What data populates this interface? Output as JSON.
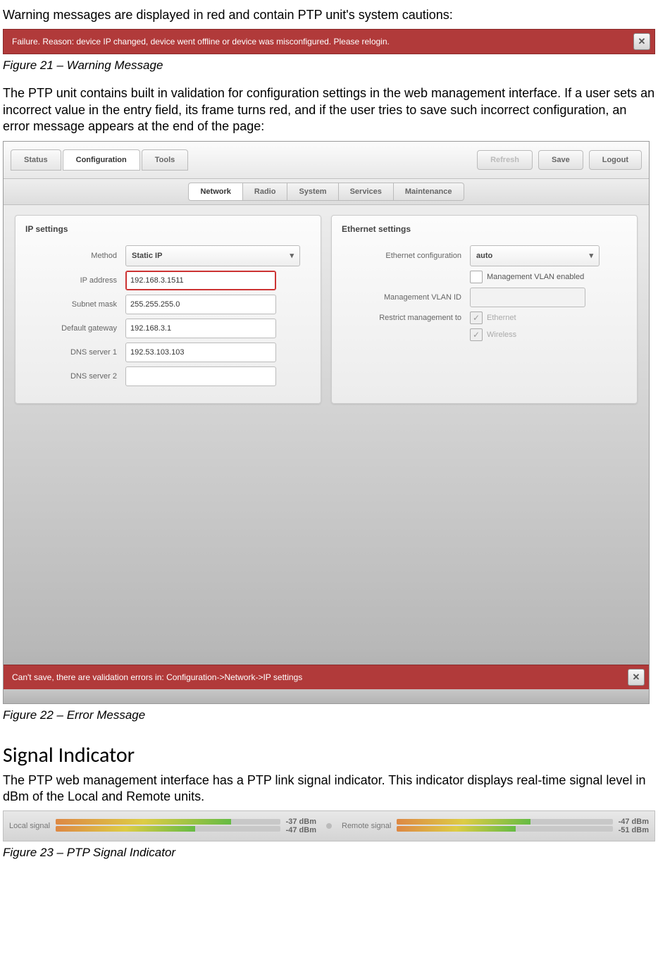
{
  "intro_para": "Warning messages are displayed in red and contain PTP unit's system cautions:",
  "fig21": {
    "text": "Failure. Reason: device IP changed, device went offline or device was misconfigured. Please relogin.",
    "caption": "Figure 21 – Warning Message"
  },
  "validation_para": "The PTP unit contains built in validation for configuration settings in the web management interface. If a user sets an incorrect value in the entry field, its frame turns red, and if the user tries to save such incorrect configuration, an error message appears at the end of the page:",
  "fig22": {
    "main_tabs": [
      "Status",
      "Configuration",
      "Tools"
    ],
    "main_active": "Configuration",
    "top_buttons": {
      "refresh": "Refresh",
      "save": "Save",
      "logout": "Logout"
    },
    "sub_tabs": [
      "Network",
      "Radio",
      "System",
      "Services",
      "Maintenance"
    ],
    "sub_active": "Network",
    "ip_panel": {
      "title": "IP settings",
      "method_label": "Method",
      "method_value": "Static IP",
      "ip_label": "IP address",
      "ip_value": "192.168.3.1511",
      "mask_label": "Subnet mask",
      "mask_value": "255.255.255.0",
      "gw_label": "Default gateway",
      "gw_value": "192.168.3.1",
      "dns1_label": "DNS server 1",
      "dns1_value": "192.53.103.103",
      "dns2_label": "DNS server 2",
      "dns2_value": ""
    },
    "eth_panel": {
      "title": "Ethernet settings",
      "cfg_label": "Ethernet configuration",
      "cfg_value": "auto",
      "vlan_en_label": "Management VLAN enabled",
      "vlan_id_label": "Management VLAN ID",
      "vlan_id_value": "",
      "restrict_label": "Restrict management to",
      "restrict_opts": [
        "Ethernet",
        "Wireless"
      ]
    },
    "error_text": "Can't save, there are validation errors in: Configuration->Network->IP settings",
    "caption": "Figure 22 – Error Message"
  },
  "signal_section": {
    "heading": "Signal Indicator",
    "para": "The PTP web management interface has a PTP link signal indicator. This indicator displays real-time signal level in dBm of the Local and Remote units.",
    "local_label": "Local signal",
    "local_top": "-37 dBm",
    "local_bot": "-47 dBm",
    "remote_label": "Remote signal",
    "remote_top": "-47 dBm",
    "remote_bot": "-51 dBm",
    "caption": "Figure 23 – PTP Signal Indicator"
  }
}
